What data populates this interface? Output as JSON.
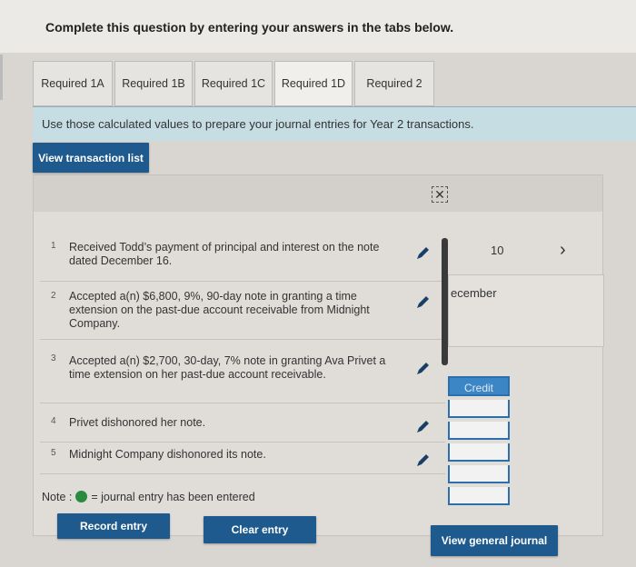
{
  "instruction": "Complete this question by entering your answers in the tabs below.",
  "tabs": [
    {
      "label": "Required 1A"
    },
    {
      "label": "Required 1B"
    },
    {
      "label": "Required 1C"
    },
    {
      "label": "Required 1D"
    },
    {
      "label": "Required 2"
    }
  ],
  "banner_text": "Use those calculated values to prepare your journal entries for Year 2 transactions.",
  "view_transaction_list": "View transaction list",
  "transactions": [
    {
      "num": "1",
      "desc": "Received Todd’s payment of principal and interest on the note dated December 16."
    },
    {
      "num": "2",
      "desc": "Accepted a(n) $6,800, 9%, 90-day note in granting a time extension on the past-due account receivable from Midnight Company."
    },
    {
      "num": "3",
      "desc": "Accepted a(n) $2,700, 30-day, 7% note in granting Ava Privet a time extension on her past-due account receivable."
    },
    {
      "num": "4",
      "desc": "Privet dishonored her note."
    },
    {
      "num": "5",
      "desc": "Midnight Company dishonored its note."
    }
  ],
  "page_number": "10",
  "right_label": "ecember",
  "credit_label": "Credit",
  "note_prefix": "Note :",
  "note_suffix": "= journal entry has been entered",
  "record_entry": "Record entry",
  "clear_entry": "Clear entry",
  "view_general_journal": "View general journal",
  "colors": {
    "button": "#1f5a8e",
    "banner": "#c6dde4",
    "credit": "#3d86c6",
    "entered_dot": "#2a8a3e"
  }
}
